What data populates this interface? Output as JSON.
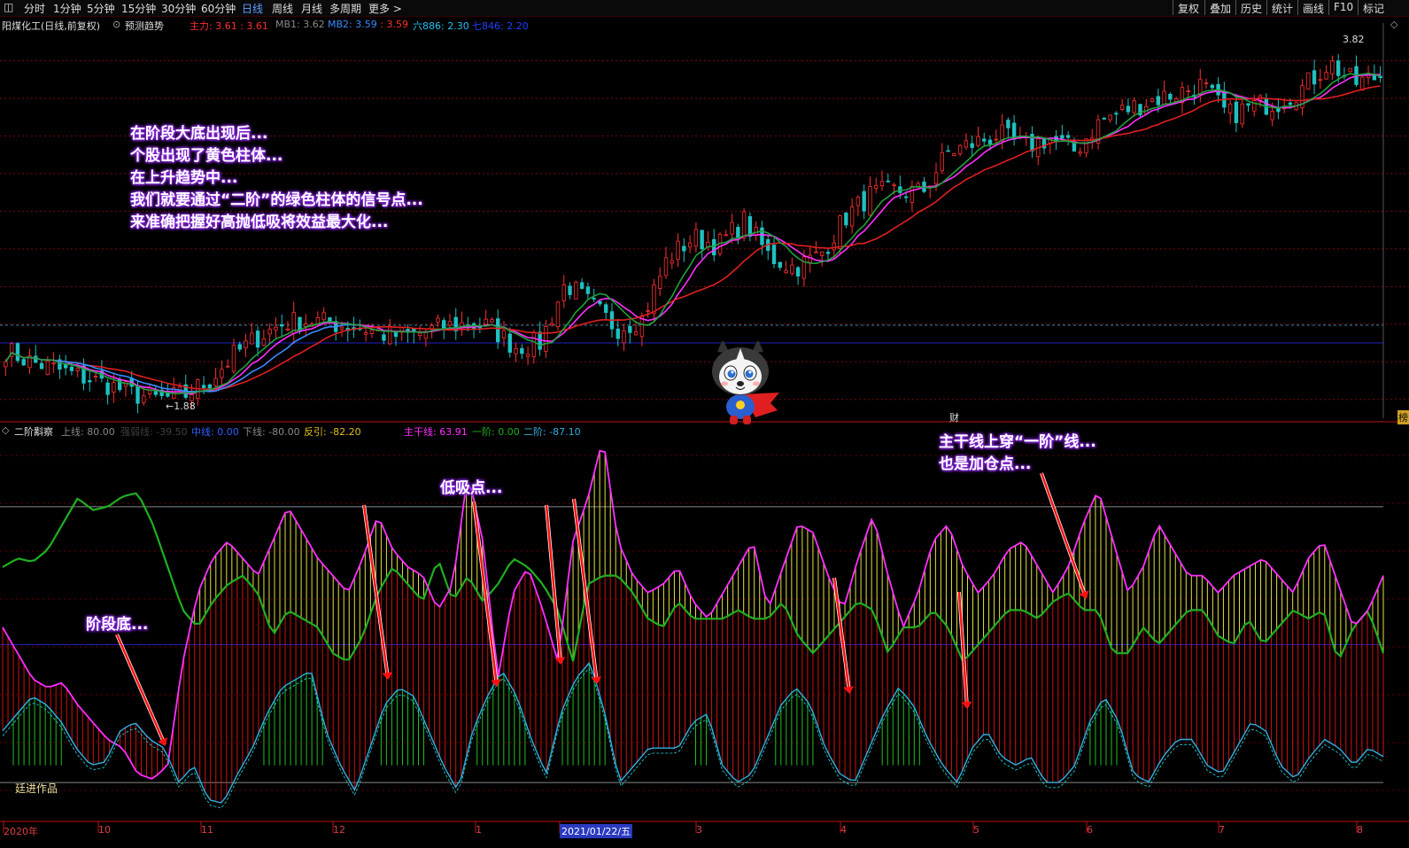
{
  "toolbar": {
    "timeframes": [
      "分时",
      "1分钟",
      "5分钟",
      "15分钟",
      "30分钟",
      "60分钟",
      "日线",
      "周线",
      "月线",
      "多周期",
      "更多 >"
    ],
    "active_index": 6,
    "right_buttons": [
      "复权",
      "叠加",
      "历史",
      "统计",
      "画线",
      "F10",
      "标记"
    ]
  },
  "main_panel": {
    "title": "阳煤化工(日线,前复权)",
    "forecast_label": "预测趋势",
    "indicators": [
      {
        "label": "主力: ",
        "value": "3.61",
        "sep": " : ",
        "value2": "3.61",
        "color": "#ff3030"
      },
      {
        "label": "MB1: ",
        "value": "3.62",
        "color": "#888888"
      },
      {
        "label": "MB2: ",
        "value": "3.59",
        "sep": " : ",
        "value2": "3.59",
        "color": "#3a8bff"
      },
      {
        "label": "六886: ",
        "value": "2.30",
        "color": "#20c0f0"
      },
      {
        "label": "七846: ",
        "value": "2.20",
        "color": "#2040ff"
      }
    ],
    "high_label": "3.82",
    "low_label": "←1.88",
    "cai_label": "财",
    "bang_label": "榜"
  },
  "sub_panel": {
    "title": "二阶斠察",
    "indicators": [
      {
        "text": "上线: 80.00",
        "color": "#888888"
      },
      {
        "text": "强弱线: -39.50",
        "color": "#404040"
      },
      {
        "text": "中线: 0.00",
        "color": "#3060ff"
      },
      {
        "text": "下线: -80.00",
        "color": "#888888"
      },
      {
        "text": "反引: -82.20",
        "color": "#e0c020"
      },
      {
        "text": "主干线: 63.91",
        "color": "#ff30ff"
      },
      {
        "text": "一阶: 0.00",
        "color": "#20b020"
      },
      {
        "text": "二阶: -87.10",
        "color": "#30b0e0"
      }
    ],
    "author_label": "廷进作品"
  },
  "annotations": {
    "main_text": [
      "在阶段大底出现后...",
      "个股出现了黄色柱体...",
      "在上升趋势中...",
      "我们就要通过“二阶”的绿色柱体的信号点...",
      "来准确把握好高抛低吸将效益最大化..."
    ],
    "stage_bottom": "阶段底...",
    "low_buy": "低吸点...",
    "trunk_cross_1": "主干线上穿“一阶”线...",
    "trunk_cross_2": "也是加仓点..."
  },
  "date_axis": {
    "labels": [
      "2020年",
      "10",
      "11",
      "12",
      "1",
      "2021/01/22/五",
      "3",
      "4",
      "5",
      "6",
      "7",
      "8"
    ]
  },
  "chart_data": [
    {
      "type": "candlestick",
      "title": "阳煤化工(日线,前复权)",
      "xlabel": "",
      "ylabel": "",
      "y_range": [
        1.8,
        3.9
      ],
      "grid": true,
      "high": 3.82,
      "low": 1.88,
      "close_path": [
        2.16,
        2.1,
        2.06,
        2.02,
        1.98,
        1.93,
        1.9,
        1.92,
        2.0,
        2.14,
        2.24,
        2.31,
        2.32,
        2.3,
        2.28,
        2.24,
        2.24,
        2.28,
        2.3,
        2.29,
        2.18,
        2.2,
        2.52,
        2.4,
        2.28,
        2.33,
        2.65,
        2.76,
        2.72,
        2.85,
        2.66,
        2.6,
        2.67,
        2.87,
        2.99,
        3.01,
        3.0,
        3.21,
        3.26,
        3.31,
        3.24,
        3.29,
        3.22,
        3.38,
        3.44,
        3.49,
        3.53,
        3.57,
        3.41,
        3.46,
        3.48,
        3.56,
        3.69,
        3.58,
        3.62
      ],
      "series": [
        {
          "name": "主力",
          "color": "#ff3030"
        },
        {
          "name": "MB1",
          "color": "#888888"
        },
        {
          "name": "MB2",
          "color": "#3a8bff"
        }
      ],
      "colors": {
        "up": "#ff3030",
        "down": "#20c0c0"
      }
    },
    {
      "type": "line",
      "title": "二阶斠察",
      "xlabel": "",
      "ylabel": "",
      "y_range": [
        -100,
        120
      ],
      "grid": true,
      "reference_lines": {
        "upper": 80,
        "middle": 0,
        "lower": -80
      },
      "series": [
        {
          "name": "主干线",
          "color": "#ff30ff",
          "values": [
            10,
            -5,
            -20,
            -25,
            -22,
            -35,
            -45,
            -55,
            -60,
            -75,
            -78,
            -70,
            -10,
            30,
            50,
            60,
            50,
            40,
            60,
            80,
            65,
            50,
            40,
            30,
            50,
            75,
            55,
            45,
            40,
            20,
            35,
            100,
            60,
            -20,
            30,
            45,
            20,
            -10,
            60,
            85,
            120,
            60,
            40,
            30,
            35,
            45,
            25,
            15,
            30,
            45,
            60,
            20,
            45,
            70,
            65,
            40,
            20,
            50,
            75,
            40,
            10,
            30,
            60,
            70,
            45,
            30,
            40,
            55,
            60,
            45,
            30,
            45,
            70,
            90,
            60,
            30,
            45,
            70,
            55,
            40,
            40,
            30,
            40,
            45,
            50,
            40,
            30,
            50,
            60,
            35,
            10,
            20,
            40
          ]
        },
        {
          "name": "一阶",
          "color": "#20b020",
          "values": [
            45,
            50,
            48,
            55,
            70,
            85,
            78,
            80,
            86,
            88,
            70,
            45,
            20,
            10,
            25,
            35,
            40,
            30,
            5,
            20,
            15,
            10,
            -5,
            -10,
            5,
            30,
            45,
            35,
            25,
            50,
            25,
            40,
            25,
            35,
            50,
            45,
            35,
            20,
            -10,
            35,
            40,
            40,
            30,
            15,
            10,
            25,
            15,
            15,
            15,
            20,
            15,
            15,
            25,
            5,
            -5,
            5,
            15,
            25,
            20,
            -5,
            10,
            10,
            20,
            10,
            -10,
            0,
            10,
            20,
            20,
            15,
            25,
            30,
            20,
            20,
            -5,
            -5,
            10,
            0,
            10,
            20,
            20,
            5,
            0,
            15,
            0,
            10,
            20,
            15,
            20,
            -10,
            10,
            20,
            -5
          ]
        },
        {
          "name": "二阶",
          "color": "#30b0e0",
          "values": [
            -50,
            -40,
            -30,
            -35,
            -45,
            -60,
            -70,
            -68,
            -50,
            -45,
            -55,
            -60,
            -80,
            -70,
            -90,
            -92,
            -75,
            -60,
            -40,
            -25,
            -20,
            -15,
            -50,
            -70,
            -85,
            -60,
            -35,
            -25,
            -30,
            -50,
            -70,
            -85,
            -50,
            -30,
            -15,
            -30,
            -55,
            -75,
            -40,
            -20,
            -10,
            -40,
            -80,
            -70,
            -60,
            -60,
            -60,
            -45,
            -40,
            -70,
            -80,
            -75,
            -55,
            -35,
            -25,
            -35,
            -60,
            -75,
            -80,
            -60,
            -40,
            -25,
            -35,
            -55,
            -70,
            -80,
            -60,
            -50,
            -65,
            -70,
            -65,
            -80,
            -80,
            -70,
            -45,
            -30,
            -45,
            -75,
            -80,
            -65,
            -55,
            -55,
            -70,
            -75,
            -60,
            -45,
            -50,
            -70,
            -78,
            -65,
            -55,
            -60,
            -70,
            -60,
            -65
          ]
        }
      ]
    }
  ]
}
